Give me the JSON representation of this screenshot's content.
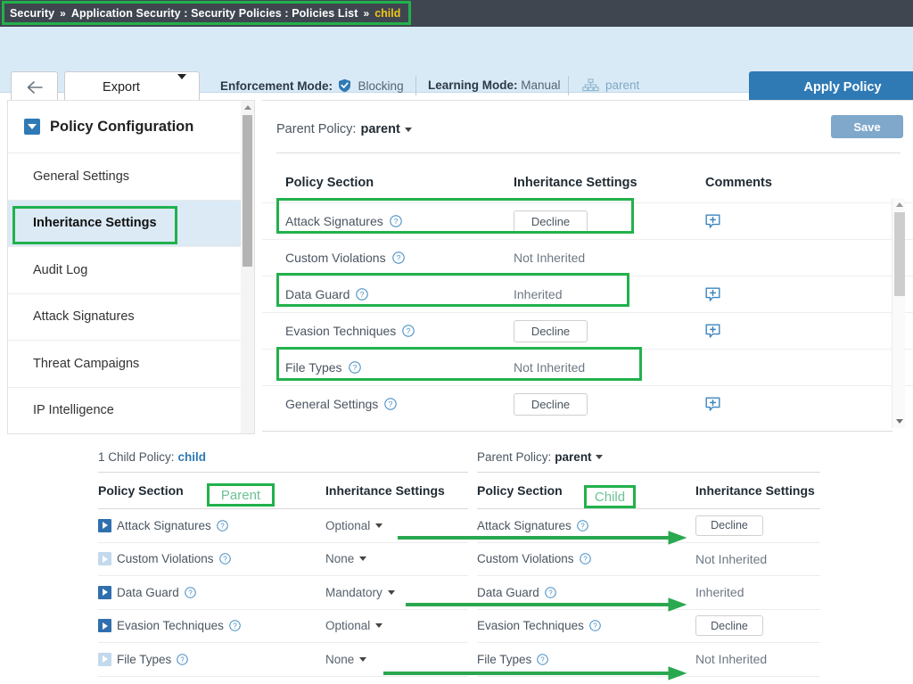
{
  "breadcrumb": {
    "root": "Security",
    "sep": "»",
    "path": "Application Security : Security Policies : Policies List",
    "current": "child"
  },
  "toolbar": {
    "back_label": "back",
    "export_label": "Export",
    "enforcement_label": "Enforcement Mode:",
    "enforcement_value": "Blocking",
    "learning_label": "Learning Mode:",
    "learning_value": "Manual",
    "parent_link": "parent",
    "apply_label": "Apply Policy"
  },
  "sidebar": {
    "title": "Policy Configuration",
    "items": [
      {
        "label": "General Settings",
        "selected": false
      },
      {
        "label": "Inheritance Settings",
        "selected": true
      },
      {
        "label": "Audit Log",
        "selected": false
      },
      {
        "label": "Attack Signatures",
        "selected": false
      },
      {
        "label": "Threat Campaigns",
        "selected": false
      },
      {
        "label": "IP Intelligence",
        "selected": false
      }
    ]
  },
  "main": {
    "parent_policy_label": "Parent Policy:",
    "parent_policy_value": "parent",
    "save_label": "Save",
    "columns": [
      "Policy Section",
      "Inheritance Settings",
      "Comments"
    ],
    "rows": [
      {
        "section": "Attack Signatures",
        "inheritance": "Decline",
        "kind": "button",
        "comment": true
      },
      {
        "section": "Custom Violations",
        "inheritance": "Not Inherited",
        "kind": "text",
        "comment": false
      },
      {
        "section": "Data Guard",
        "inheritance": "Inherited",
        "kind": "text",
        "comment": true
      },
      {
        "section": "Evasion Techniques",
        "inheritance": "Decline",
        "kind": "button",
        "comment": true
      },
      {
        "section": "File Types",
        "inheritance": "Not Inherited",
        "kind": "text",
        "comment": false
      },
      {
        "section": "General Settings",
        "inheritance": "Decline",
        "kind": "button",
        "comment": true
      }
    ]
  },
  "compare_left": {
    "caption_prefix": "1 Child Policy:",
    "caption_value": "child",
    "badge": "Parent",
    "columns": [
      "Policy Section",
      "Inheritance Settings"
    ],
    "rows": [
      {
        "section": "Attack Signatures",
        "value": "Optional",
        "enabled": true
      },
      {
        "section": "Custom Violations",
        "value": "None",
        "enabled": false
      },
      {
        "section": "Data Guard",
        "value": "Mandatory",
        "enabled": true
      },
      {
        "section": "Evasion Techniques",
        "value": "Optional",
        "enabled": true
      },
      {
        "section": "File Types",
        "value": "None",
        "enabled": false
      }
    ]
  },
  "compare_right": {
    "caption_prefix": "Parent Policy:",
    "caption_value": "parent",
    "badge": "Child",
    "columns": [
      "Policy Section",
      "Inheritance Settings"
    ],
    "rows": [
      {
        "section": "Attack Signatures",
        "value": "Decline",
        "kind": "button"
      },
      {
        "section": "Custom Violations",
        "value": "Not Inherited",
        "kind": "text"
      },
      {
        "section": "Data Guard",
        "value": "Inherited",
        "kind": "text"
      },
      {
        "section": "Evasion Techniques",
        "value": "Decline",
        "kind": "button"
      },
      {
        "section": "File Types",
        "value": "Not Inherited",
        "kind": "text"
      }
    ]
  },
  "colors": {
    "annotation": "#22b14c",
    "breadcrumb_bg": "#3f4650",
    "breadcrumb_current": "#f0c419",
    "accent_blue": "#2f7ab5",
    "toolbar_bg": "#d9eaf7"
  }
}
